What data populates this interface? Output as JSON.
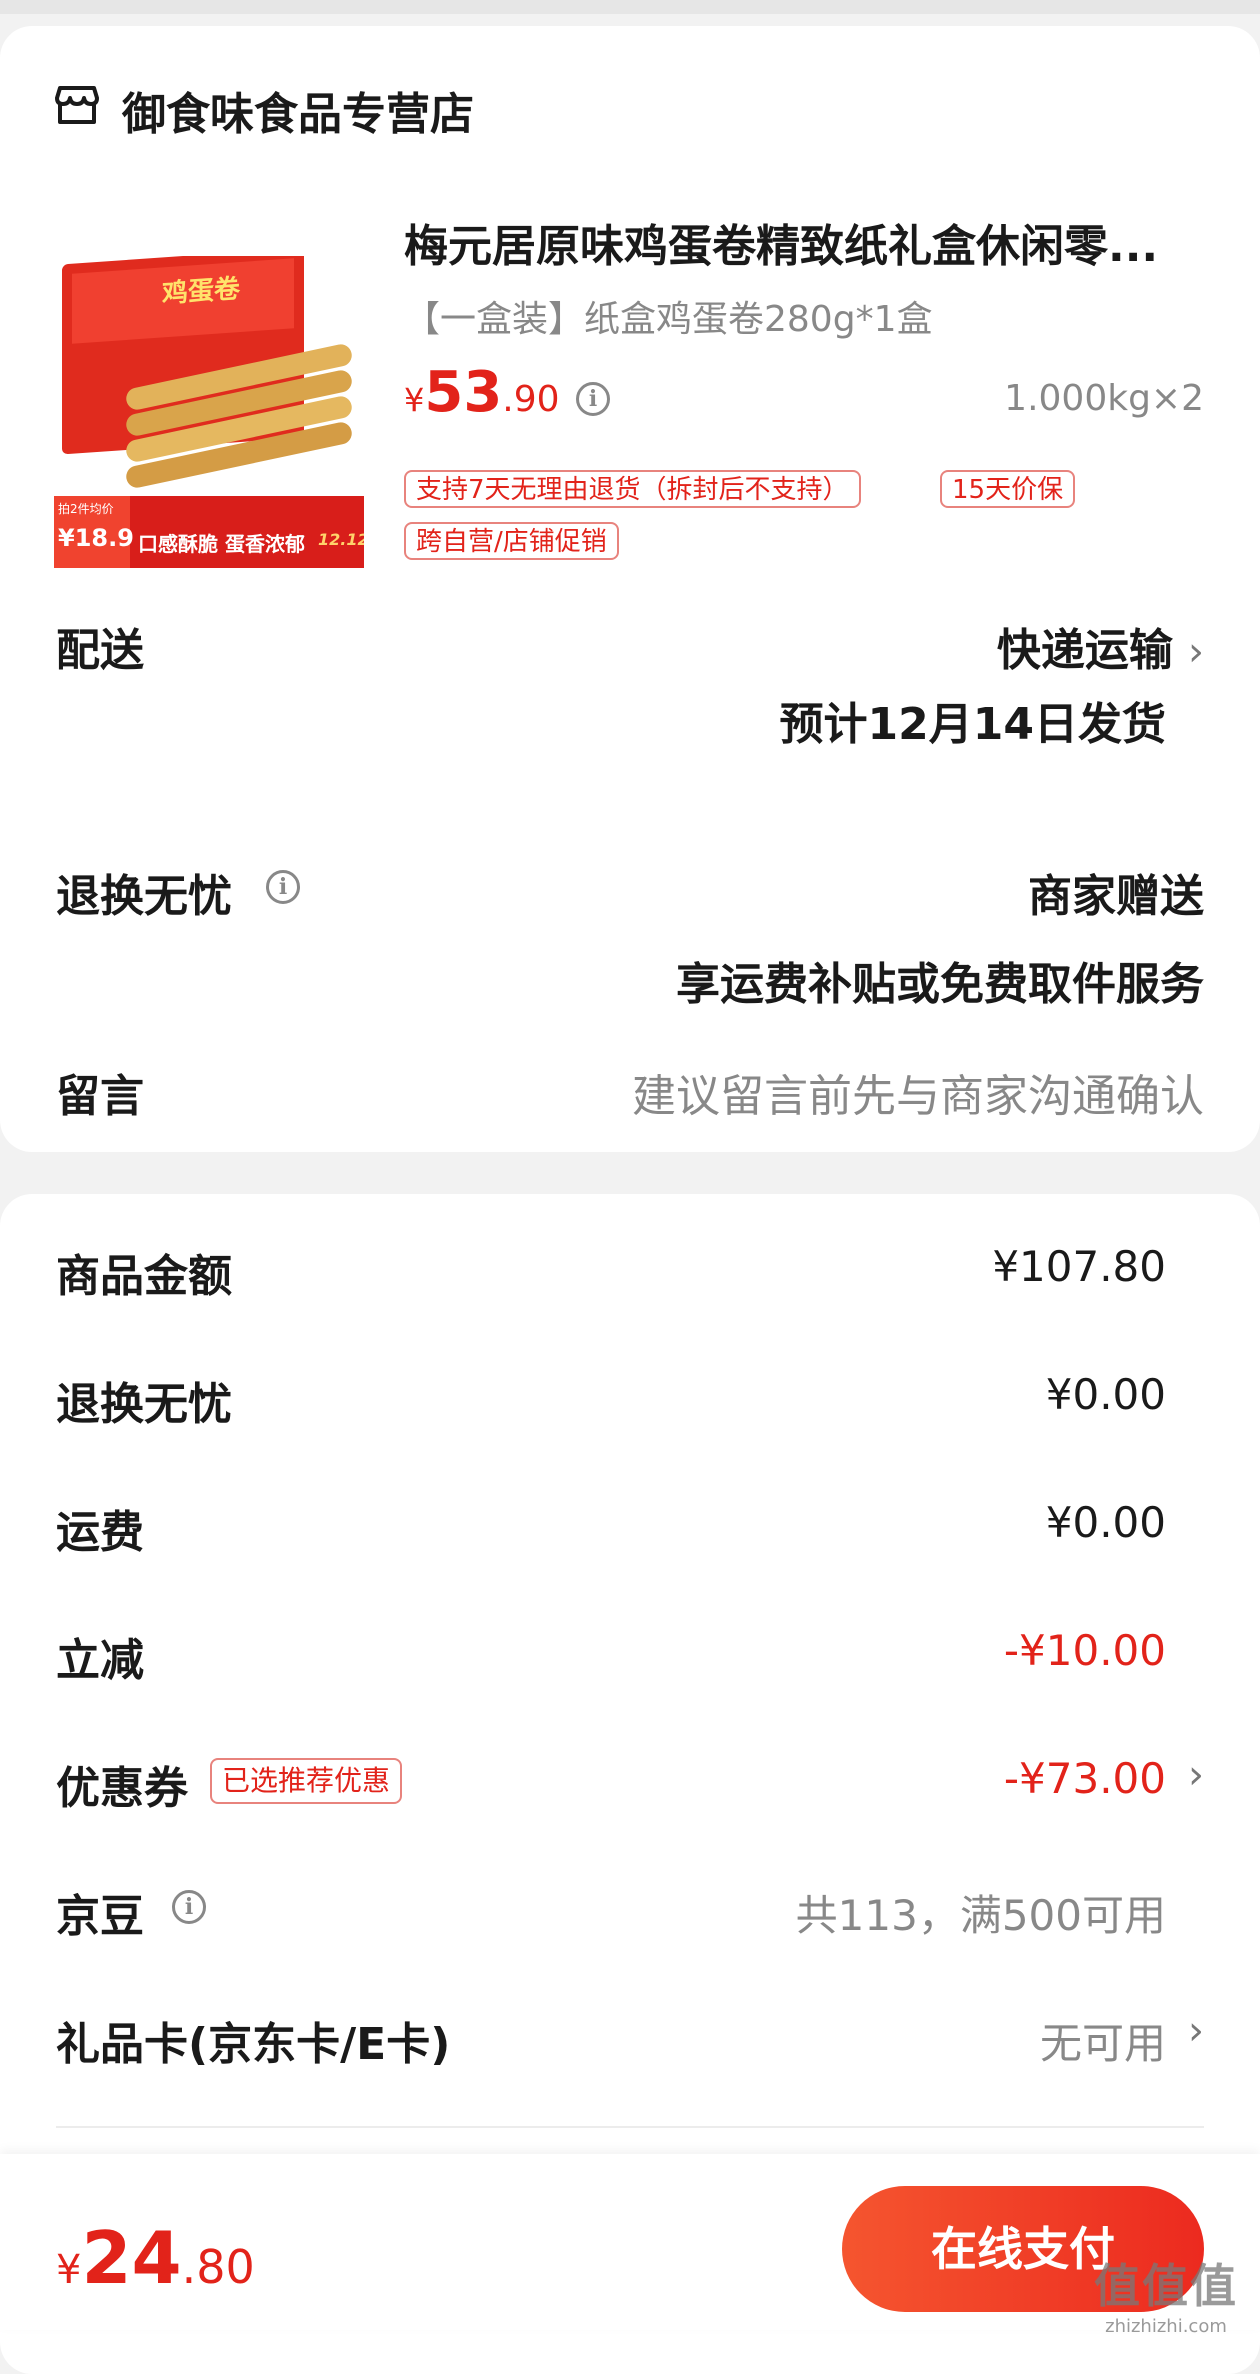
{
  "store": {
    "name": "御食味食品专营店",
    "icon": "store-icon"
  },
  "product": {
    "title": "梅元居原味鸡蛋卷精致纸礼盒休闲零...",
    "spec": "【一盒装】纸盒鸡蛋卷280g*1盒",
    "price_symbol": "¥",
    "price_int": "53",
    "price_dec": ".90",
    "quantity": "1.000kg×2",
    "tags": [
      "支持7天无理由退货（拆封后不支持）",
      "15天价保",
      "跨自营/店铺促销"
    ],
    "image": {
      "box_title": "鸡蛋卷",
      "promo_small": "拍2件均价",
      "promo_price": "¥18.9",
      "banner": "口感酥脆 蛋香浓郁",
      "badge": "12.12"
    }
  },
  "delivery": {
    "label": "配送",
    "method": "快递运输",
    "estimate": "预计12月14日发货"
  },
  "return_worry_free": {
    "label": "退换无忧",
    "value": "商家赠送",
    "desc": "享运费补贴或免费取件服务"
  },
  "message": {
    "label": "留言",
    "placeholder": "建议留言前先与商家沟通确认"
  },
  "summary": {
    "goods_amount": {
      "label": "商品金额",
      "value": "¥107.80"
    },
    "return_fee": {
      "label": "退换无忧",
      "value": "¥0.00"
    },
    "shipping": {
      "label": "运费",
      "value": "¥0.00"
    },
    "instant_discount": {
      "label": "立减",
      "value": "-¥10.00"
    },
    "coupon": {
      "label": "优惠券",
      "badge": "已选推荐优惠",
      "value": "-¥73.00"
    },
    "jd_beans": {
      "label": "京豆",
      "value": "共113，满500可用"
    },
    "gift_card": {
      "label": "礼品卡(京东卡/E卡)",
      "value": "无可用"
    }
  },
  "footer": {
    "total_symbol": "¥",
    "total_int": "24",
    "total_dec": ".80",
    "pay_button": "在线支付"
  },
  "watermark": {
    "text": "值值值",
    "url": "zhizhizhi.com"
  },
  "colors": {
    "accent": "#e2231a",
    "button": "#f1452d"
  }
}
